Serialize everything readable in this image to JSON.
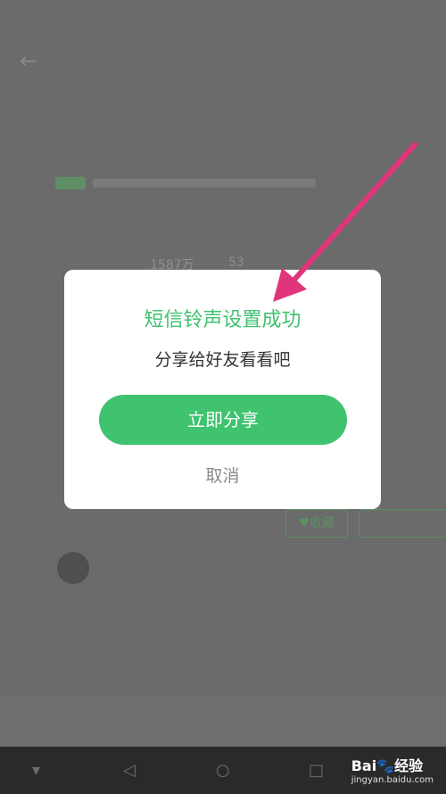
{
  "dialog": {
    "title": "短信铃声设置成功",
    "message": "分享给好友看看吧",
    "share_button": "立即分享",
    "cancel_button": "取消"
  },
  "background": {
    "stats": [
      "1587万",
      "53"
    ],
    "favorite_label": "♥收藏"
  },
  "watermark": {
    "brand": "Bai🐾经验",
    "site": "jingyan.baidu.com"
  },
  "colors": {
    "accent_green": "#3fc36f",
    "arrow_pink": "#e0357a",
    "overlay": "#6b6b6b"
  }
}
